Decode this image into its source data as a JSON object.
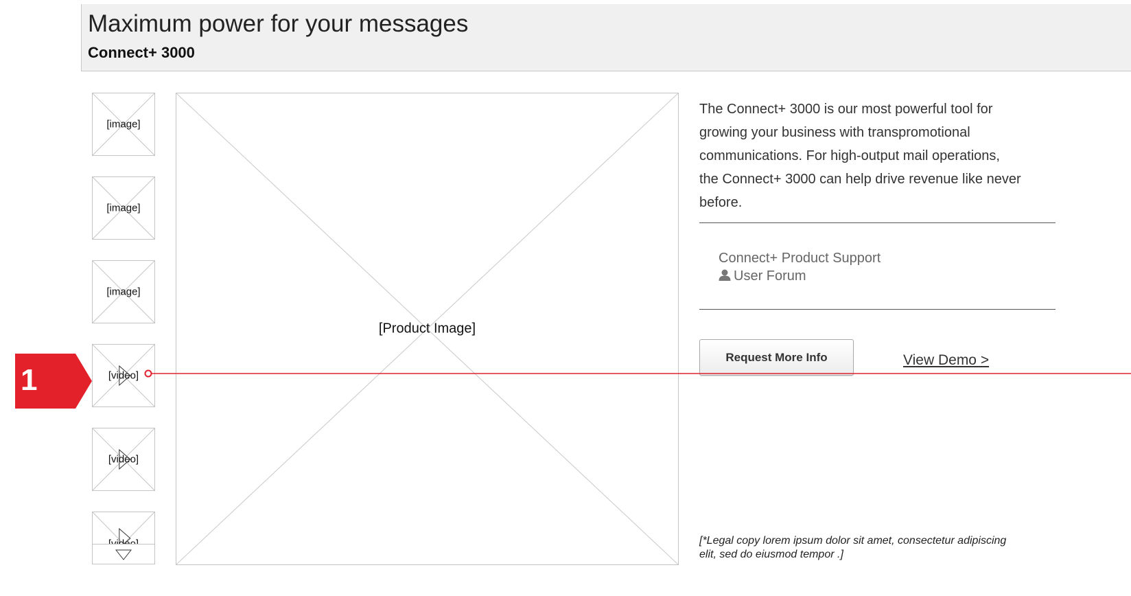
{
  "header": {
    "title": "Maximum power for your messages",
    "subtitle": "Connect+ 3000"
  },
  "thumbnails": [
    {
      "label": "[image]",
      "kind": "image"
    },
    {
      "label": "[image]",
      "kind": "image"
    },
    {
      "label": "[image]",
      "kind": "image"
    },
    {
      "label": "[video]",
      "kind": "video"
    },
    {
      "label": "[video]",
      "kind": "video"
    },
    {
      "label": "[video]",
      "kind": "video"
    }
  ],
  "thumbnail_scroll": {
    "icon": "chevron-down-icon"
  },
  "main_image": {
    "label": "[Product Image]"
  },
  "description": "The Connect+ 3000 is our most powerful tool for growing your business with transpromotional communications. For high-output mail operations, the Connect+ 3000 can help drive revenue like never before.",
  "links": {
    "support": "Connect+ Product Support",
    "forum": "User Forum",
    "forum_icon": "user-icon"
  },
  "actions": {
    "request_info": "Request More Info",
    "view_demo": "View Demo >"
  },
  "legal": "[*Legal copy lorem ipsum dolor sit amet, consectetur adipiscing elit, sed do eiusmod tempor .]",
  "annotation": {
    "number": "1",
    "color": "#e3212b"
  }
}
